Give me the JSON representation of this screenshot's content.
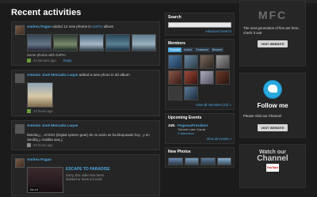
{
  "main": {
    "title": "Recent activities",
    "activity1": {
      "user": "Andrea Pagan",
      "action": "added 12 new photos in",
      "album": "GoPro",
      "album_suffix": "album",
      "caption": "Some photos with GoPro",
      "time": "24 minutes ago",
      "reply": "Reply"
    },
    "activity2": {
      "user": "Antonio José Mercado Luque",
      "action": "added a new photo in dd album",
      "time": "23 hours ago"
    },
    "activity3": {
      "user": "Antonio José Mercado Luque",
      "text": "Mierda¡¡¡ , el DSG (Digital system gear) de mi avión se ha bloqueado hoy , y en Sevilla¡¡¡ maldita sea¡¡¡",
      "time": "23 hours ago"
    },
    "activity4": {
      "user": "Andrea Pagan",
      "video_title": "ESCAPE TO PARADISE",
      "video_desc": "Sorry, this video has been deleted or does not exist.",
      "video_duration": "04:10"
    }
  },
  "side": {
    "search": {
      "title": "Search",
      "advanced": "Advanced Search"
    },
    "members": {
      "title": "Members",
      "tabs": [
        "Popular",
        "Active",
        "Featured",
        "Newest"
      ],
      "view_all": "View all members (10) »"
    },
    "events": {
      "title": "Upcoming Events",
      "date": "JUN",
      "event_title": "PegasusPresident",
      "event_place": "Torbole Lake Garda",
      "event_attendees": "3 attendees",
      "view_all": "View all events »"
    },
    "new_photos": {
      "title": "New Photos"
    }
  },
  "right": {
    "promo": {
      "logo": "MFC",
      "text": "The next generation of fins are here, check it out!",
      "button": "VISIT WEBSITE"
    },
    "twitter": {
      "title": "Follow me",
      "text": "Please Visit our Channel",
      "button": "VISIT WEBSITE"
    },
    "channel": {
      "line1": "Watch our",
      "line2": "Channel",
      "badge": "YouTube"
    }
  },
  "colors": {
    "accent": "#4ca8e0",
    "background": "#1b1b1b",
    "twitter": "#2aa8e0"
  }
}
